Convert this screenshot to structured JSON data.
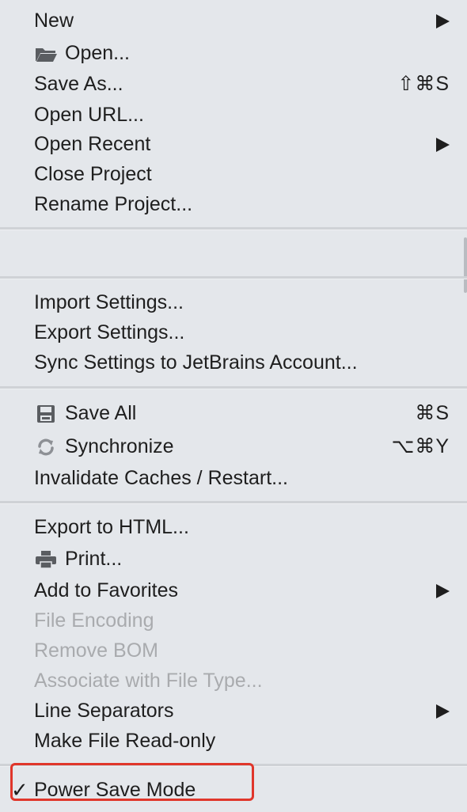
{
  "menu": {
    "items": {
      "new": {
        "label": "New",
        "has_submenu": true
      },
      "open": {
        "label": "Open...",
        "icon": "folder-icon"
      },
      "save_as": {
        "label": "Save As...",
        "shortcut": "⇧⌘S"
      },
      "open_url": {
        "label": "Open URL..."
      },
      "open_recent": {
        "label": "Open Recent",
        "has_submenu": true
      },
      "close_project": {
        "label": "Close Project"
      },
      "rename_project": {
        "label": "Rename Project..."
      },
      "import_settings": {
        "label": "Import Settings..."
      },
      "export_settings": {
        "label": "Export Settings..."
      },
      "sync_settings": {
        "label": "Sync Settings to JetBrains Account..."
      },
      "save_all": {
        "label": "Save All",
        "icon": "floppy-disk-icon",
        "shortcut": "⌘S"
      },
      "synchronize": {
        "label": "Synchronize",
        "icon": "sync-icon",
        "shortcut": "⌥⌘Y"
      },
      "invalidate_caches": {
        "label": "Invalidate Caches / Restart..."
      },
      "export_html": {
        "label": "Export to HTML..."
      },
      "print": {
        "label": "Print...",
        "icon": "printer-icon"
      },
      "add_favorites": {
        "label": "Add to Favorites",
        "has_submenu": true
      },
      "file_encoding": {
        "label": "File Encoding",
        "disabled": true
      },
      "remove_bom": {
        "label": "Remove BOM",
        "disabled": true
      },
      "associate_file_type": {
        "label": "Associate with File Type...",
        "disabled": true
      },
      "line_separators": {
        "label": "Line Separators",
        "has_submenu": true
      },
      "make_read_only": {
        "label": "Make File Read-only"
      },
      "power_save_mode": {
        "label": "Power Save Mode",
        "checked": true,
        "check_glyph": "✓",
        "highlighted": true
      }
    }
  },
  "colors": {
    "menu_background": "#e4e7eb",
    "text": "#1e1e1e",
    "disabled_text": "#a9abae",
    "highlight_border": "#e0362b"
  }
}
